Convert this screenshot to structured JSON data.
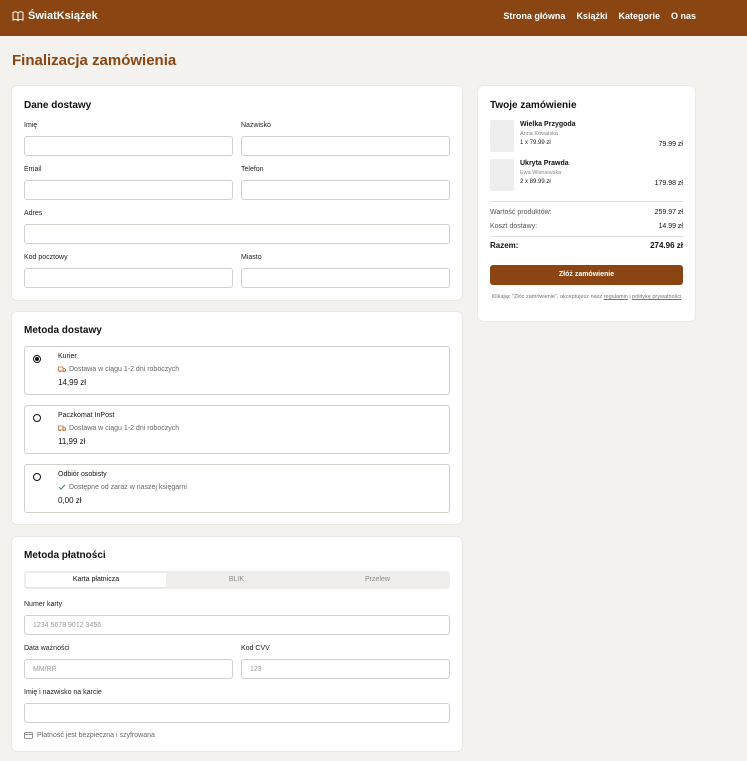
{
  "header": {
    "logo_text": "ŚwiatKsiążek",
    "nav": [
      "Strona główna",
      "Książki",
      "Kategorie",
      "O nas"
    ]
  },
  "page_title": "Finalizacja zamówienia",
  "delivery": {
    "title": "Dane dostawy",
    "first_name": "Imię",
    "last_name": "Nazwisko",
    "email": "Email",
    "phone": "Telefon",
    "address": "Adres",
    "postal_code": "Kod pocztowy",
    "city": "Miasto"
  },
  "shipping": {
    "title": "Metoda dostawy",
    "options": [
      {
        "name": "Kurier",
        "desc": "Dostawa w ciągu 1-2 dni roboczych",
        "price": "14,99 zł",
        "icon": "truck-icon",
        "selected": true
      },
      {
        "name": "Paczkomat InPost",
        "desc": "Dostawa w ciągu 1-2 dni roboczych",
        "price": "11,99 zł",
        "icon": "truck-icon",
        "selected": false
      },
      {
        "name": "Odbiór osobisty",
        "desc": "Dostępne od zaraz w naszej księgarni",
        "price": "0,00 zł",
        "icon": "check-icon",
        "selected": false
      }
    ]
  },
  "payment": {
    "title": "Metoda płatności",
    "tabs": [
      "Karta płatnicza",
      "BLIK",
      "Przelew"
    ],
    "active_tab": "Karta płatnicza",
    "card_number_label": "Numer karty",
    "card_number_placeholder": "1234 5678 9012 3456",
    "expiry_label": "Data ważności",
    "expiry_placeholder": "MM/RR",
    "cvv_label": "Kod CVV",
    "cvv_placeholder": "123",
    "name_label": "Imię i nazwisko na karcie",
    "secure_note": "Płatność jest bezpieczna i szyfrowana"
  },
  "order": {
    "title": "Twoje zamówienie",
    "items": [
      {
        "title": "Wielka Przygoda",
        "author": "Anna Kowalska",
        "qty": "1 x 79.99 zł",
        "price": "79.99 zł"
      },
      {
        "title": "Ukryta Prawda",
        "author": "Ewa Wiśniewska",
        "qty": "2 x 89.99 zł",
        "price": "179.98 zł"
      }
    ],
    "products_label": "Wartość produktów:",
    "products_value": "259.97 zł",
    "shipping_label": "Koszt dostawy:",
    "shipping_value": "14.99 zł",
    "total_label": "Razem:",
    "total_value": "274.96 zł",
    "button": "Złóż zamówienie",
    "terms_prefix": "Klikając \"Złóż zamówienie\", akceptujesz nasz",
    "terms_link": "regulamin",
    "terms_and": "i",
    "privacy_link": "politykę prywatności"
  },
  "colors": {
    "brand": "#8b4513",
    "background": "#f4f2ef"
  }
}
